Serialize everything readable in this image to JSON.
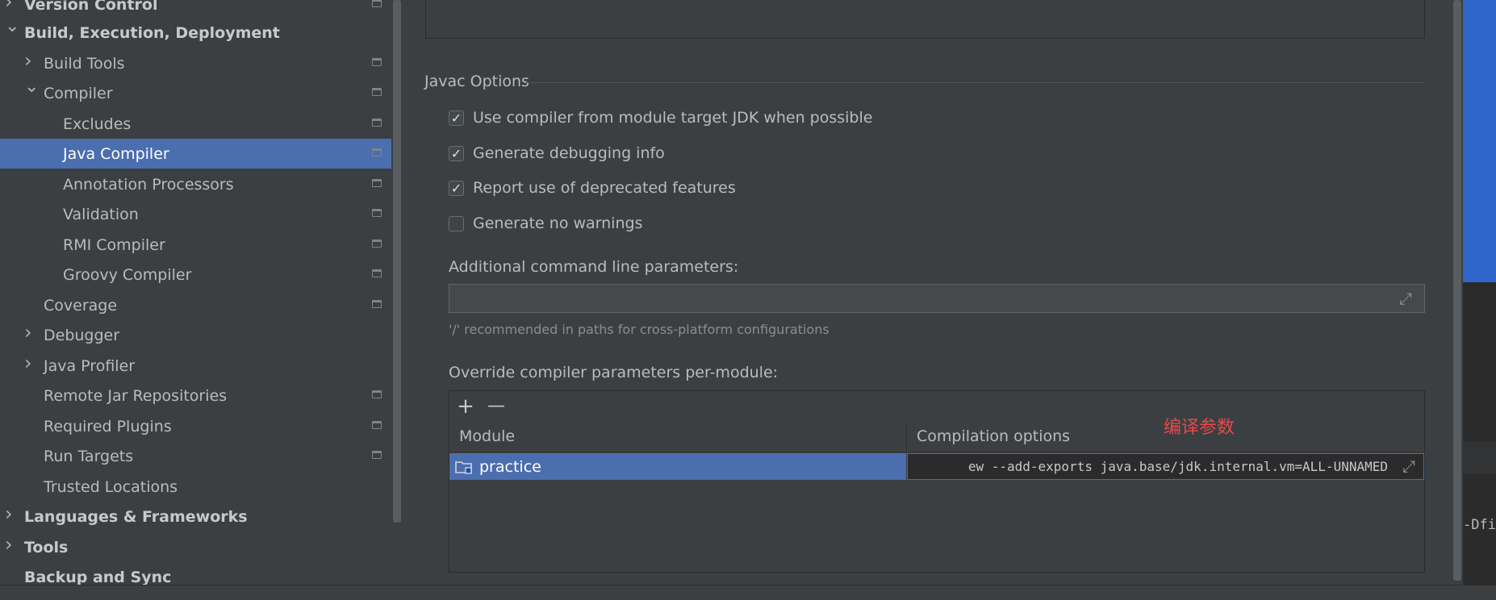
{
  "sidebar": {
    "items": [
      {
        "label": "Version Control",
        "bold": true,
        "chevron": "right",
        "pin": true
      },
      {
        "label": "Build, Execution, Deployment",
        "bold": true,
        "chevron": "down",
        "pin": false
      },
      {
        "label": "Build Tools",
        "bold": false,
        "chevron": "right",
        "pin": true
      },
      {
        "label": "Compiler",
        "bold": false,
        "chevron": "down",
        "pin": true
      },
      {
        "label": "Excludes",
        "bold": false,
        "chevron": "",
        "pin": true
      },
      {
        "label": "Java Compiler",
        "bold": false,
        "chevron": "",
        "pin": true,
        "selected": true
      },
      {
        "label": "Annotation Processors",
        "bold": false,
        "chevron": "",
        "pin": true
      },
      {
        "label": "Validation",
        "bold": false,
        "chevron": "",
        "pin": true
      },
      {
        "label": "RMI Compiler",
        "bold": false,
        "chevron": "",
        "pin": true
      },
      {
        "label": "Groovy Compiler",
        "bold": false,
        "chevron": "",
        "pin": true
      },
      {
        "label": "Coverage",
        "bold": false,
        "chevron": "",
        "pin": true
      },
      {
        "label": "Debugger",
        "bold": false,
        "chevron": "right",
        "pin": false
      },
      {
        "label": "Java Profiler",
        "bold": false,
        "chevron": "right",
        "pin": false
      },
      {
        "label": "Remote Jar Repositories",
        "bold": false,
        "chevron": "",
        "pin": true
      },
      {
        "label": "Required Plugins",
        "bold": false,
        "chevron": "",
        "pin": true
      },
      {
        "label": "Run Targets",
        "bold": false,
        "chevron": "",
        "pin": true
      },
      {
        "label": "Trusted Locations",
        "bold": false,
        "chevron": "",
        "pin": false
      },
      {
        "label": "Languages & Frameworks",
        "bold": true,
        "chevron": "right",
        "pin": false
      },
      {
        "label": "Tools",
        "bold": true,
        "chevron": "right",
        "pin": false
      },
      {
        "label": "Backup and Sync",
        "bold": true,
        "chevron": "",
        "pin": false
      }
    ]
  },
  "javac": {
    "section_title": "Javac Options",
    "options": [
      {
        "label": "Use compiler from module target JDK when possible",
        "checked": true
      },
      {
        "label": "Generate debugging info",
        "checked": true
      },
      {
        "label": "Report use of deprecated features",
        "checked": true
      },
      {
        "label": "Generate no warnings",
        "checked": false
      }
    ],
    "additional_label": "Additional command line parameters:",
    "additional_value": "",
    "hint": "'/' recommended in paths for cross-platform configurations",
    "override_label": "Override compiler parameters per-module:",
    "table": {
      "add_icon": "+",
      "remove_icon": "—",
      "columns": [
        "Module",
        "Compilation options"
      ],
      "rows": [
        {
          "module": "practice",
          "options": "ew --add-exports java.base/jdk.internal.vm=ALL-UNNAMED"
        }
      ]
    }
  },
  "annotation": "编译参数",
  "editor_fragment": "-Dfi",
  "colors": {
    "selection": "#4b6eaf",
    "annotation": "#e8484a",
    "editor_blue": "#2f65ca"
  }
}
